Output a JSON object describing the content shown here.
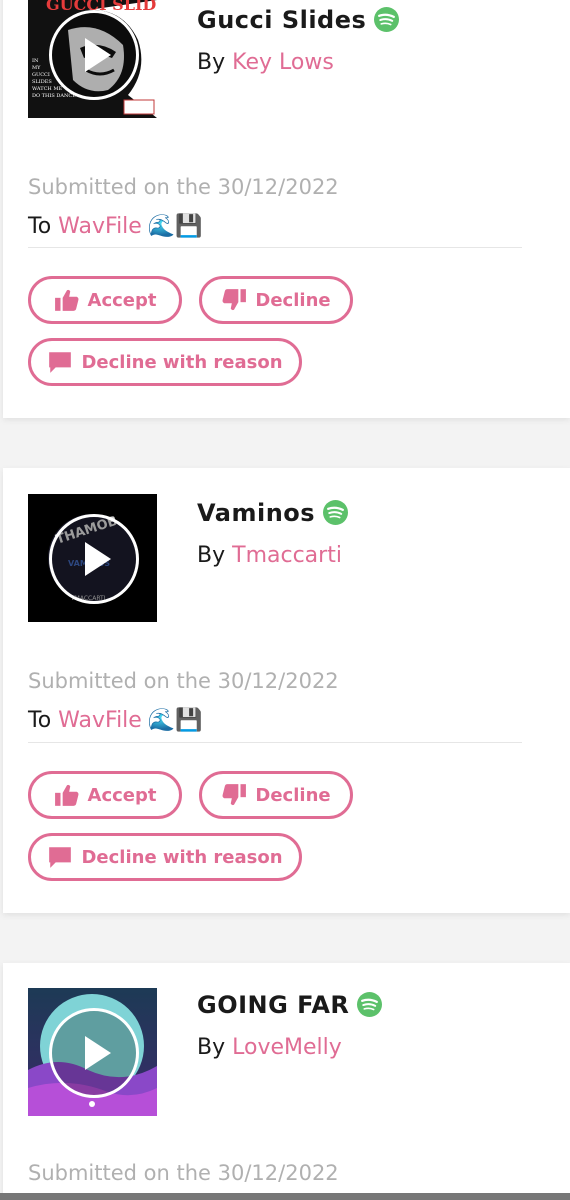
{
  "accent_color": "#e06c94",
  "submissions": [
    {
      "title": "Gucci Slides",
      "by_prefix": "By",
      "artist": "Key Lows",
      "submitted": "Submitted on the 30/12/2022",
      "to_prefix": "To",
      "playlist": "WavFile",
      "playlist_emoji": "🌊💾",
      "cover_text": "GUCCI SLIDES",
      "cover_lyrics": [
        "IN",
        "MY",
        "GUCCI",
        "SLIDES",
        "WATCH ME",
        "DO THIS DANCE"
      ],
      "streaming_icon": "spotify-icon",
      "play_icon": "play-icon"
    },
    {
      "title": "Vaminos",
      "by_prefix": "By",
      "artist": "Tmaccarti",
      "submitted": "Submitted on the 30/12/2022",
      "to_prefix": "To",
      "playlist": "WavFile",
      "playlist_emoji": "🌊💾",
      "cover_text": "THAMOB",
      "cover_subtext": "VAMINOS",
      "cover_footer": "TMACCARTI",
      "streaming_icon": "spotify-icon",
      "play_icon": "play-icon"
    },
    {
      "title": "GOING FAR",
      "by_prefix": "By",
      "artist": "LoveMelly",
      "submitted": "Submitted on the 30/12/2022",
      "streaming_icon": "spotify-icon",
      "play_icon": "play-icon"
    }
  ],
  "actions": {
    "accept": "Accept",
    "decline": "Decline",
    "decline_reason": "Decline with reason",
    "accept_icon": "thumbs-up-icon",
    "decline_icon": "thumbs-down-icon",
    "reason_icon": "comment-icon"
  }
}
